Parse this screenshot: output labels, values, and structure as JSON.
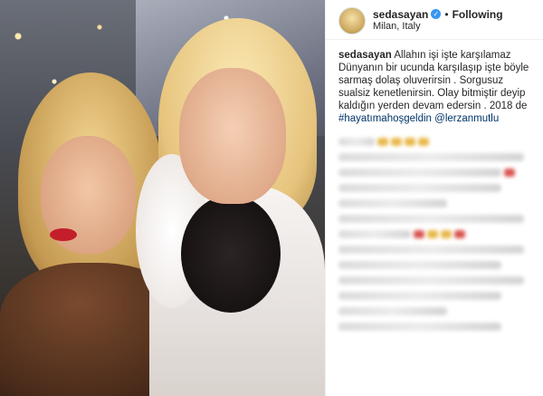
{
  "post": {
    "username": "sedasayan",
    "verified_icon": "verified-badge-icon",
    "separator": "•",
    "follow_status": "Following",
    "location": "Milan, Italy",
    "caption": {
      "username": "sedasayan",
      "text": "Allahın işi işte karşılamaz Dünyanın bir ucunda karşılaşıp işte böyle sarmaş dolaş oluverirsin . Sorgusuz sualsiz kenetlenirsin. Olay bitmiştir deyip kaldığın yerden devam edersin . 2018 de",
      "hashtag": "#hayatımahoşgeldin",
      "mention": "@lerzanmutlu"
    }
  },
  "colors": {
    "link": "#003569",
    "verified": "#3897f0",
    "blur_accent_yellow": "#e8b84a",
    "blur_accent_red": "#d9534f"
  }
}
